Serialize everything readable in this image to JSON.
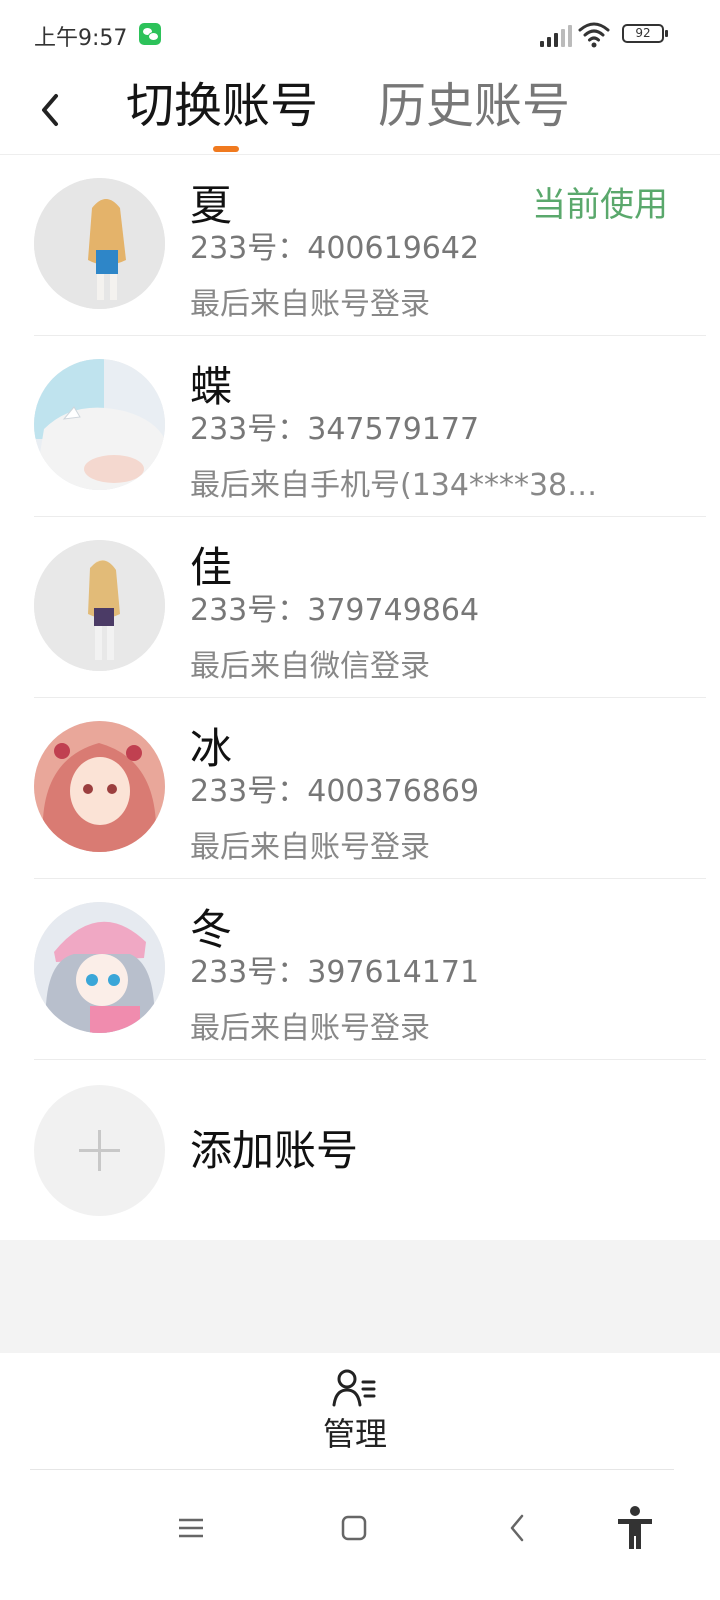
{
  "status_bar": {
    "time": "上午9:57",
    "battery": "92",
    "icons": [
      "wechat-notification-icon",
      "signal-icon",
      "wifi-icon",
      "battery-icon"
    ]
  },
  "header": {
    "back_icon": "chevron-left-icon",
    "tabs": [
      {
        "label": "切换账号",
        "active": true
      },
      {
        "label": "历史账号",
        "active": false
      }
    ],
    "accent_color": "#f07a1f"
  },
  "accounts": [
    {
      "name": "夏",
      "id": "233号：400619642",
      "source": "最后来自账号登录",
      "current": "当前使用"
    },
    {
      "name": "蝶",
      "id": "233号：347579177",
      "source": "最后来自手机号(134****38…"
    },
    {
      "name": "佳",
      "id": "233号：379749864",
      "source": "最后来自微信登录"
    },
    {
      "name": "冰",
      "id": "233号：400376869",
      "source": "最后来自账号登录"
    },
    {
      "name": "冬",
      "id": "233号：397614171",
      "source": "最后来自账号登录"
    }
  ],
  "current_color": "#5aa86c",
  "add_account": {
    "label": "添加账号",
    "icon": "plus-icon"
  },
  "manage": {
    "label": "管理",
    "icon": "user-list-icon"
  },
  "system_nav": [
    "menu-icon",
    "home-icon",
    "back-icon",
    "accessibility-icon"
  ]
}
